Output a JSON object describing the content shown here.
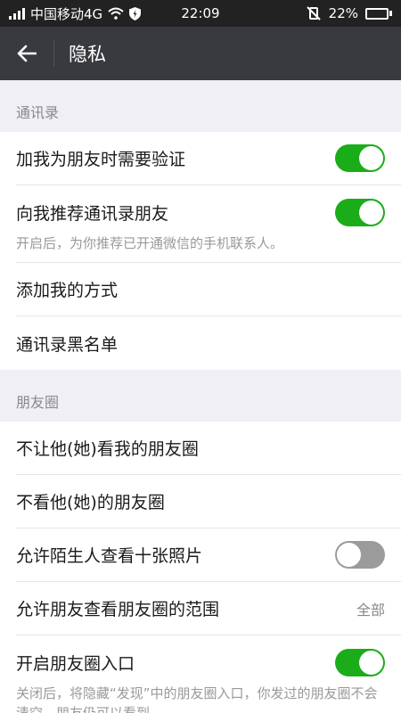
{
  "status_bar": {
    "carrier": "中国移动4G",
    "time": "22:09",
    "battery": "22%",
    "battery_level": 0.22
  },
  "nav": {
    "title": "隐私"
  },
  "sections": {
    "contacts": {
      "header": "通讯录",
      "verify_label": "加我为朋友时需要验证",
      "verify_on": true,
      "recommend_label": "向我推荐通讯录朋友",
      "recommend_on": true,
      "recommend_desc": "开启后，为你推荐已开通微信的手机联系人。",
      "add_methods_label": "添加我的方式",
      "blacklist_label": "通讯录黑名单"
    },
    "moments": {
      "header": "朋友圈",
      "hide_mine_label": "不让他(她)看我的朋友圈",
      "hide_theirs_label": "不看他(她)的朋友圈",
      "stranger_label": "允许陌生人查看十张照片",
      "stranger_on": false,
      "range_label": "允许朋友查看朋友圈的范围",
      "range_value": "全部",
      "entry_label": "开启朋友圈入口",
      "entry_on": true,
      "entry_desc": "关闭后，将隐藏“发现”中的朋友圈入口，你发过的朋友圈不会清空，朋友仍可以看到。"
    }
  },
  "colors": {
    "toggle_on": "#1aad19",
    "toggle_off": "#9b9b9b",
    "navbar": "#393a3f"
  }
}
